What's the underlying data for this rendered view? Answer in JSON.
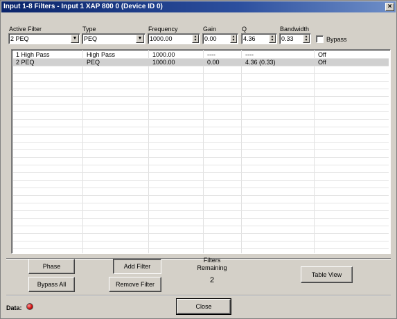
{
  "window": {
    "title": "Input 1-8 Filters - Input 1  XAP 800 0 (Device ID 0)",
    "close_glyph": "×"
  },
  "controls": {
    "active_filter": {
      "label": "Active Filter",
      "value": "2 PEQ"
    },
    "type": {
      "label": "Type",
      "value": "PEQ"
    },
    "frequency": {
      "label": "Frequency",
      "value": "1000.00"
    },
    "gain": {
      "label": "Gain",
      "value": "0.00"
    },
    "q": {
      "label": "Q",
      "value": "4.36"
    },
    "bandwidth": {
      "label": "Bandwidth",
      "value": "0.33"
    },
    "bypass": {
      "label": "Bypass",
      "checked": false
    }
  },
  "filters_table": {
    "rows": [
      [
        "1 High Pass",
        "High Pass",
        "1000.00",
        "----",
        "----",
        "Off"
      ],
      [
        "2 PEQ",
        "PEQ",
        "1000.00",
        "0.00",
        "4.36 (0.33)",
        "Off"
      ]
    ],
    "selected_row": 1
  },
  "buttons": {
    "phase": "Phase",
    "bypass_all": "Bypass All",
    "add_filter": "Add Filter",
    "remove_filter": "Remove Filter",
    "table_view": "Table View",
    "close": "Close"
  },
  "filters_remaining": {
    "label_line1": "Filters",
    "label_line2": "Remaining",
    "count": "2"
  },
  "status": {
    "data_label": "Data:",
    "led_color": "#d01010"
  }
}
